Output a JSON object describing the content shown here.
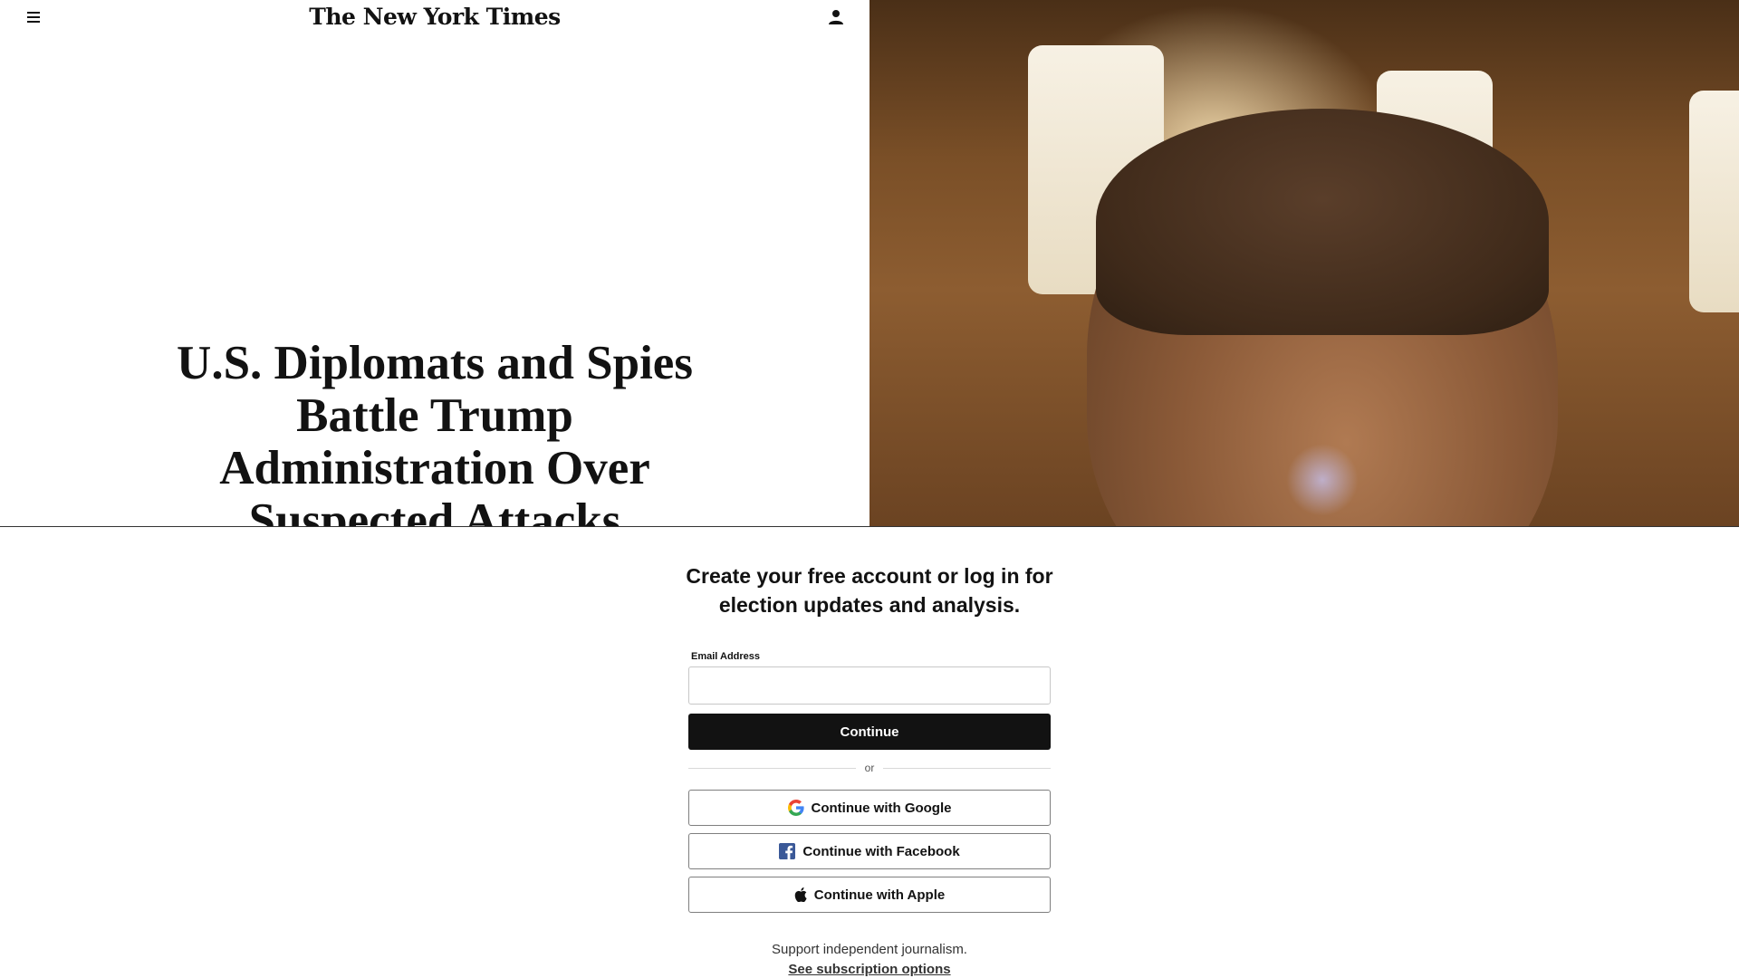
{
  "header": {
    "masthead": "The New York Times"
  },
  "article": {
    "headline": "U.S. Diplomats and Spies Battle Trump Administration Over Suspected Attacks"
  },
  "gate": {
    "title": "Create your free account or log in for election updates and analysis.",
    "email_label": "Email Address",
    "email_value": "",
    "continue_label": "Continue",
    "or_label": "or",
    "google_label": "Continue with Google",
    "facebook_label": "Continue with Facebook",
    "apple_label": "Continue with Apple",
    "support_text": "Support independent journalism.",
    "subscription_link": "See subscription options"
  },
  "icons": {
    "menu": "hamburger-menu-icon",
    "account": "user-account-icon",
    "google": "google-logo-icon",
    "facebook": "facebook-logo-icon",
    "apple": "apple-logo-icon"
  },
  "colors": {
    "primary_button": "#121212",
    "facebook_blue": "#3b5998",
    "text": "#121212"
  }
}
